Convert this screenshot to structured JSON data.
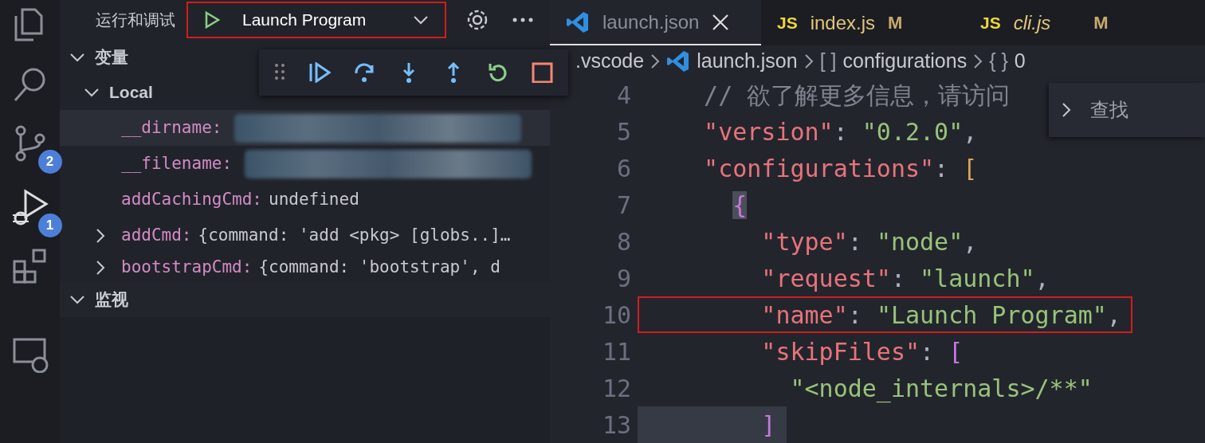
{
  "activity_bar": {
    "source_control_badge": "2",
    "run_debug_badge": "1"
  },
  "sidebar": {
    "title": "运行和调试",
    "launch_config": {
      "label": "Launch Program",
      "highlighted": true
    },
    "sections": [
      {
        "title": "变量",
        "expanded": true,
        "scopes": [
          {
            "title": "Local",
            "expanded": true,
            "variables": [
              {
                "name": "__dirname:",
                "redacted": true,
                "expandable": false,
                "selected": true
              },
              {
                "name": "__filename:",
                "redacted": true,
                "expandable": false,
                "selected": false
              },
              {
                "name": "addCachingCmd:",
                "value": "undefined",
                "redacted": false,
                "expandable": false,
                "selected": false
              },
              {
                "name": "addCmd:",
                "value": "{command: 'add <pkg> [globs..]…",
                "redacted": false,
                "expandable": true,
                "selected": false
              },
              {
                "name": "bootstrapCmd:",
                "value": "{command: 'bootstrap', d",
                "redacted": false,
                "expandable": true,
                "selected": false
              }
            ]
          }
        ]
      },
      {
        "title": "监视",
        "expanded": true
      }
    ]
  },
  "debug_toolbar": {
    "visible": true
  },
  "editor": {
    "tabs": [
      {
        "label": "launch.json",
        "kind": "json",
        "selected": true,
        "preview": false
      },
      {
        "label": "index.js",
        "kind": "js",
        "badge_text": "JS",
        "modified": "M",
        "selected": false,
        "preview": false
      },
      {
        "label": "cli.js",
        "kind": "js",
        "badge_text": "JS",
        "modified": "M",
        "selected": false,
        "preview": true
      }
    ],
    "breadcrumb": [
      {
        "label": ".vscode",
        "kind": "folder"
      },
      {
        "label": "launch.json",
        "kind": "file"
      },
      {
        "label": "configurations",
        "kind": "symbol",
        "symbol": "[ ]"
      },
      {
        "label": "0",
        "kind": "symbol",
        "symbol": "{ }"
      }
    ],
    "find_widget": {
      "label": "查找",
      "expanded": false
    },
    "lines": [
      {
        "number": "4",
        "highlighted": false,
        "current": false,
        "tokens": [
          {
            "text": "  // 欲了解更多信息，请访问",
            "kind": "comment"
          }
        ]
      },
      {
        "number": "5",
        "highlighted": false,
        "current": false,
        "tokens": [
          {
            "text": "  \"version\"",
            "kind": "key"
          },
          {
            "text": ": ",
            "kind": "punct"
          },
          {
            "text": "\"0.2.0\"",
            "kind": "string"
          },
          {
            "text": ",",
            "kind": "punct"
          }
        ]
      },
      {
        "number": "6",
        "highlighted": false,
        "current": false,
        "tokens": [
          {
            "text": "  \"configurations\"",
            "kind": "key"
          },
          {
            "text": ": ",
            "kind": "punct"
          },
          {
            "text": "[",
            "kind": "bracket_gold"
          }
        ]
      },
      {
        "number": "7",
        "highlighted": false,
        "current": false,
        "tokens": [
          {
            "text": "    {",
            "kind": "bracket_purple",
            "matched": true
          }
        ]
      },
      {
        "number": "8",
        "highlighted": false,
        "current": false,
        "tokens": [
          {
            "text": "      \"type\"",
            "kind": "key"
          },
          {
            "text": ": ",
            "kind": "punct"
          },
          {
            "text": "\"node\"",
            "kind": "string"
          },
          {
            "text": ",",
            "kind": "punct"
          }
        ]
      },
      {
        "number": "9",
        "highlighted": false,
        "current": false,
        "tokens": [
          {
            "text": "      \"request\"",
            "kind": "key"
          },
          {
            "text": ": ",
            "kind": "punct"
          },
          {
            "text": "\"launch\"",
            "kind": "string"
          },
          {
            "text": ",",
            "kind": "punct"
          }
        ]
      },
      {
        "number": "10",
        "highlighted": true,
        "current": false,
        "tokens": [
          {
            "text": "      \"name\"",
            "kind": "key"
          },
          {
            "text": ": ",
            "kind": "punct"
          },
          {
            "text": "\"Launch Program\"",
            "kind": "string"
          },
          {
            "text": ",",
            "kind": "punct"
          }
        ]
      },
      {
        "number": "11",
        "highlighted": false,
        "current": false,
        "tokens": [
          {
            "text": "      \"skipFiles\"",
            "kind": "key"
          },
          {
            "text": ": ",
            "kind": "punct"
          },
          {
            "text": "[",
            "kind": "bracket_purple"
          }
        ]
      },
      {
        "number": "12",
        "highlighted": false,
        "current": false,
        "tokens": [
          {
            "text": "        \"<node_internals>/**\"",
            "kind": "string"
          }
        ]
      },
      {
        "number": "13",
        "highlighted": false,
        "current": true,
        "tokens": [
          {
            "text": "      ]",
            "kind": "bracket_purple"
          }
        ]
      }
    ]
  }
}
